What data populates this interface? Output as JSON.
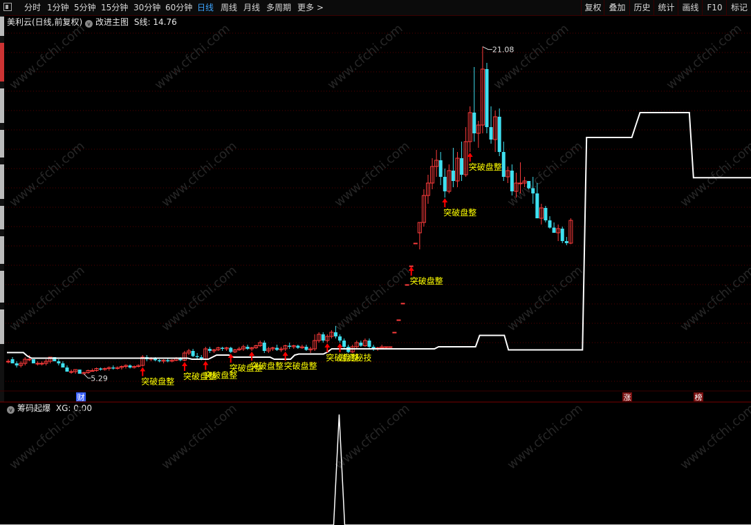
{
  "toolbar": {
    "tabs": [
      {
        "label": "分时",
        "active": false
      },
      {
        "label": "1分钟",
        "active": false
      },
      {
        "label": "5分钟",
        "active": false
      },
      {
        "label": "15分钟",
        "active": false
      },
      {
        "label": "30分钟",
        "active": false
      },
      {
        "label": "60分钟",
        "active": false
      },
      {
        "label": "日线",
        "active": true
      },
      {
        "label": "周线",
        "active": false
      },
      {
        "label": "月线",
        "active": false
      },
      {
        "label": "多周期",
        "active": false
      },
      {
        "label": "更多 >",
        "active": false
      }
    ],
    "right": [
      "复权",
      "叠加",
      "历史",
      "统计",
      "画线",
      "F10",
      "标记"
    ]
  },
  "main": {
    "stock": "美利云(日线,前复权)",
    "indicator": "改进主图",
    "s_label": "S线:",
    "s_value": "14.76",
    "high_label": "21.08",
    "low_label": "5.29",
    "bottom_markers": [
      "财",
      "涨",
      "榜"
    ]
  },
  "sub": {
    "indicator": "筹码起爆",
    "xg_label": "XG:",
    "xg_value": "0.00"
  },
  "watermark": "www.cfchi.com",
  "colors": {
    "up": "#ff3c3c",
    "down": "#3fe0f0",
    "sline": "#ffffff",
    "signal": "#ffff00",
    "arrow": "#ff0000",
    "active": "#3da5ff"
  },
  "chart_data": {
    "type": "candlestick",
    "y_range": [
      4.5,
      22.0
    ],
    "candles": [
      [
        5.9,
        6.0,
        5.8,
        5.9
      ],
      [
        6.0,
        6.1,
        5.8,
        5.8
      ],
      [
        5.8,
        5.9,
        5.6,
        5.7
      ],
      [
        5.7,
        5.9,
        5.6,
        5.8
      ],
      [
        5.8,
        6.1,
        5.7,
        6.0
      ],
      [
        6.0,
        6.2,
        5.9,
        6.0
      ],
      [
        6.0,
        6.0,
        5.8,
        5.8
      ],
      [
        5.8,
        5.9,
        5.7,
        5.8
      ],
      [
        5.8,
        5.9,
        5.7,
        5.8
      ],
      [
        5.8,
        6.0,
        5.7,
        5.9
      ],
      [
        5.9,
        6.1,
        5.8,
        6.1
      ],
      [
        6.1,
        6.1,
        5.9,
        5.9
      ],
      [
        5.9,
        6.0,
        5.7,
        5.8
      ],
      [
        5.8,
        5.9,
        5.6,
        5.6
      ],
      [
        5.6,
        5.7,
        5.4,
        5.4
      ],
      [
        5.4,
        5.5,
        5.3,
        5.4
      ],
      [
        5.4,
        5.5,
        5.3,
        5.5
      ],
      [
        5.5,
        5.5,
        5.3,
        5.3
      ],
      [
        5.3,
        5.4,
        5.29,
        5.35
      ],
      [
        5.35,
        5.5,
        5.3,
        5.45
      ],
      [
        5.45,
        5.55,
        5.4,
        5.45
      ],
      [
        5.45,
        5.6,
        5.4,
        5.55
      ],
      [
        5.55,
        5.6,
        5.45,
        5.5
      ],
      [
        5.5,
        5.6,
        5.45,
        5.55
      ],
      [
        5.55,
        5.65,
        5.45,
        5.6
      ],
      [
        5.6,
        5.7,
        5.5,
        5.55
      ],
      [
        5.55,
        5.65,
        5.5,
        5.6
      ],
      [
        5.6,
        5.7,
        5.5,
        5.65
      ],
      [
        5.65,
        5.75,
        5.55,
        5.7
      ],
      [
        5.7,
        5.75,
        5.55,
        5.6
      ],
      [
        5.6,
        5.7,
        5.55,
        5.65
      ],
      [
        5.65,
        5.75,
        5.6,
        5.7
      ],
      [
        5.7,
        6.2,
        5.65,
        6.1
      ],
      [
        6.1,
        6.2,
        5.9,
        6.0
      ],
      [
        6.0,
        6.1,
        5.9,
        6.05
      ],
      [
        6.05,
        6.1,
        5.9,
        5.95
      ],
      [
        5.95,
        6.0,
        5.85,
        5.9
      ],
      [
        5.9,
        6.0,
        5.8,
        5.95
      ],
      [
        5.95,
        6.05,
        5.85,
        5.9
      ],
      [
        5.9,
        6.0,
        5.85,
        5.95
      ],
      [
        5.95,
        6.1,
        5.9,
        6.05
      ],
      [
        6.05,
        6.1,
        5.9,
        5.95
      ],
      [
        5.95,
        6.4,
        5.9,
        6.3
      ],
      [
        6.3,
        6.5,
        6.2,
        6.4
      ],
      [
        6.4,
        6.5,
        6.1,
        6.15
      ],
      [
        6.15,
        6.3,
        6.0,
        6.1
      ],
      [
        6.1,
        6.2,
        5.95,
        6.0
      ],
      [
        6.0,
        6.6,
        5.95,
        6.5
      ],
      [
        6.5,
        6.6,
        6.3,
        6.4
      ],
      [
        6.4,
        6.5,
        6.3,
        6.45
      ],
      [
        6.45,
        6.6,
        6.4,
        6.55
      ],
      [
        6.55,
        6.6,
        6.4,
        6.5
      ],
      [
        6.5,
        6.6,
        6.4,
        6.55
      ],
      [
        6.55,
        6.6,
        6.3,
        6.35
      ],
      [
        6.35,
        6.5,
        6.3,
        6.45
      ],
      [
        6.45,
        6.6,
        6.4,
        6.5
      ],
      [
        6.5,
        6.7,
        6.4,
        6.6
      ],
      [
        6.6,
        6.7,
        6.45,
        6.5
      ],
      [
        6.5,
        6.6,
        6.4,
        6.55
      ],
      [
        6.55,
        6.7,
        6.5,
        6.65
      ],
      [
        6.65,
        6.9,
        6.6,
        6.8
      ],
      [
        6.8,
        6.9,
        6.3,
        6.4
      ],
      [
        6.4,
        6.6,
        6.3,
        6.5
      ],
      [
        6.5,
        6.6,
        6.4,
        6.55
      ],
      [
        6.55,
        6.7,
        6.4,
        6.45
      ],
      [
        6.45,
        6.6,
        6.35,
        6.5
      ],
      [
        6.5,
        6.7,
        6.4,
        6.65
      ],
      [
        6.65,
        6.8,
        6.5,
        6.6
      ],
      [
        6.6,
        6.7,
        6.5,
        6.65
      ],
      [
        6.65,
        6.7,
        6.5,
        6.55
      ],
      [
        6.55,
        6.7,
        6.5,
        6.6
      ],
      [
        6.6,
        6.7,
        6.4,
        6.45
      ],
      [
        6.45,
        6.6,
        6.3,
        6.5
      ],
      [
        6.5,
        7.2,
        6.4,
        6.9
      ],
      [
        6.9,
        7.3,
        6.8,
        7.2
      ],
      [
        7.2,
        7.3,
        6.8,
        6.9
      ],
      [
        6.9,
        7.2,
        6.8,
        7.1
      ],
      [
        7.1,
        7.4,
        7.0,
        7.3
      ],
      [
        7.3,
        7.6,
        7.0,
        7.1
      ],
      [
        7.1,
        7.2,
        6.8,
        6.9
      ],
      [
        6.9,
        7.0,
        6.5,
        6.6
      ],
      [
        6.6,
        6.7,
        6.3,
        6.35
      ],
      [
        6.35,
        6.7,
        6.3,
        6.6
      ],
      [
        6.6,
        6.9,
        6.5,
        6.8
      ],
      [
        6.8,
        6.9,
        6.6,
        6.65
      ],
      [
        6.65,
        7.0,
        6.6,
        6.9
      ],
      [
        6.9,
        7.0,
        6.5,
        6.6
      ],
      [
        6.6,
        6.7,
        6.4,
        6.5
      ],
      [
        6.5,
        6.6,
        6.4,
        6.55
      ],
      [
        6.55,
        6.7,
        6.5,
        6.6
      ],
      [
        6.6,
        6.6,
        6.5,
        6.6
      ],
      [
        6.6,
        6.6,
        6.6,
        6.6
      ],
      [
        7.3,
        7.3,
        7.3,
        7.3
      ],
      [
        7.9,
        7.9,
        7.9,
        7.9
      ],
      [
        8.7,
        8.7,
        8.7,
        8.7
      ],
      [
        9.6,
        9.6,
        9.6,
        9.6
      ],
      [
        10.5,
        10.5,
        10.5,
        10.5
      ],
      [
        11.6,
        11.6,
        11.6,
        11.6
      ],
      [
        12.1,
        12.6,
        11.3,
        12.6
      ],
      [
        12.6,
        14.2,
        12.4,
        13.9
      ],
      [
        13.9,
        14.9,
        13.5,
        14.5
      ],
      [
        14.5,
        15.7,
        14.2,
        15.3
      ],
      [
        15.3,
        16.1,
        14.8,
        15.6
      ],
      [
        15.6,
        16.0,
        14.4,
        14.8
      ],
      [
        14.8,
        15.2,
        13.8,
        14.1
      ],
      [
        14.1,
        15.4,
        14.0,
        15.1
      ],
      [
        15.1,
        16.2,
        14.3,
        14.6
      ],
      [
        14.6,
        16.0,
        14.3,
        15.7
      ],
      [
        15.7,
        16.5,
        14.6,
        14.9
      ],
      [
        14.9,
        17.2,
        14.8,
        16.5
      ],
      [
        16.5,
        18.2,
        16.0,
        17.9
      ],
      [
        17.9,
        20.1,
        16.5,
        16.9
      ],
      [
        16.9,
        17.5,
        16.2,
        17.3
      ],
      [
        17.3,
        21.08,
        16.9,
        20.0
      ],
      [
        20.0,
        20.3,
        16.9,
        17.2
      ],
      [
        17.2,
        18.2,
        16.4,
        16.6
      ],
      [
        16.6,
        18.0,
        16.0,
        17.7
      ],
      [
        17.7,
        18.1,
        15.8,
        16.0
      ],
      [
        16.0,
        16.5,
        14.6,
        14.8
      ],
      [
        14.8,
        15.3,
        14.5,
        15.1
      ],
      [
        15.1,
        15.4,
        13.9,
        14.1
      ],
      [
        14.1,
        15.0,
        13.8,
        14.5
      ],
      [
        14.5,
        15.5,
        14.0,
        14.5
      ],
      [
        14.5,
        14.8,
        14.3,
        14.6
      ],
      [
        14.6,
        14.6,
        14.2,
        14.25
      ],
      [
        14.25,
        14.8,
        13.5,
        14.0
      ],
      [
        14.0,
        14.5,
        12.8,
        12.8
      ],
      [
        12.8,
        13.5,
        12.5,
        13.3
      ],
      [
        13.3,
        13.4,
        12.6,
        12.7
      ],
      [
        12.7,
        12.9,
        12.3,
        12.35
      ],
      [
        12.35,
        12.6,
        12.1,
        12.1
      ],
      [
        12.1,
        12.5,
        11.7,
        12.3
      ],
      [
        12.3,
        12.4,
        11.6,
        11.7
      ],
      [
        11.7,
        11.9,
        11.5,
        11.6
      ],
      [
        11.6,
        12.8,
        11.55,
        12.7
      ]
    ],
    "s_line": [
      6.32,
      6.32,
      6.32,
      6.32,
      6.32,
      6.15,
      6.05,
      6.05,
      6.05,
      6.05,
      6.05,
      6.05,
      6.05,
      6.05,
      6.05,
      6.05,
      6.05,
      6.05,
      6.05,
      6.05,
      6.05,
      6.05,
      6.05,
      6.05,
      6.05,
      6.05,
      6.05,
      6.05,
      6.05,
      6.05,
      6.05,
      6.05,
      6.05,
      6.05,
      6.05,
      6.05,
      6.05,
      6.05,
      6.05,
      6.05,
      6.05,
      6.05,
      6.05,
      6.05,
      6.05,
      6.0,
      6.0,
      6.0,
      6.0,
      6.0,
      6.1,
      6.2,
      6.2,
      6.2,
      6.2,
      6.1,
      6.1,
      6.1,
      6.1,
      6.1,
      6.1,
      6.1,
      6.1,
      6.1,
      6.1,
      6.0,
      6.0,
      6.0,
      6.0,
      6.0,
      6.2,
      6.25,
      6.25,
      6.25,
      6.25,
      6.25,
      6.25,
      6.25,
      6.35,
      6.5,
      6.5,
      6.5,
      6.5,
      6.5,
      6.5,
      6.5,
      6.5,
      6.5,
      6.5,
      6.5,
      6.5,
      6.5,
      6.5,
      6.5,
      6.5,
      6.5,
      6.5,
      6.5,
      6.5,
      6.5,
      6.5,
      6.5,
      6.5,
      6.5,
      6.5,
      6.6,
      6.6,
      6.6,
      6.6,
      6.6,
      6.6,
      6.6,
      6.6,
      6.6,
      6.6,
      7.15,
      7.15,
      7.15,
      7.15,
      7.15,
      7.15,
      7.15,
      6.45,
      6.45,
      6.45,
      6.45,
      6.45,
      6.45,
      6.45,
      6.45,
      6.45,
      6.45,
      6.45,
      6.45,
      6.45,
      6.45,
      6.45,
      6.45,
      6.45,
      6.45,
      6.45,
      16.7,
      16.7,
      16.7,
      16.7,
      16.7,
      16.7,
      16.7,
      16.7,
      16.7,
      16.7,
      16.7,
      16.7,
      17.3,
      17.9,
      17.9,
      17.9,
      17.9,
      17.9,
      17.9,
      17.9,
      17.9,
      17.9,
      17.9,
      17.9,
      17.9,
      17.9,
      14.76,
      14.76,
      14.76,
      14.76,
      14.76,
      14.76,
      14.76,
      14.76,
      14.76,
      14.76,
      14.76,
      14.76,
      14.76,
      14.76,
      14.76
    ],
    "signals": [
      {
        "i": 32,
        "label": "突破盘整"
      },
      {
        "i": 42,
        "label": "突破盘整"
      },
      {
        "i": 47,
        "label": "突破盘整"
      },
      {
        "i": 53,
        "label": "突破盘整"
      },
      {
        "i": 58,
        "label": "突破盘整"
      },
      {
        "i": 66,
        "label": "突破盘整"
      },
      {
        "i": 76,
        "label": "突破盘整"
      },
      {
        "i": 79,
        "label": "游资秘技"
      },
      {
        "i": 96,
        "label": "突破盘整"
      },
      {
        "i": 104,
        "label": "突破盘整"
      },
      {
        "i": 110,
        "label": "突破盘整"
      }
    ],
    "xg": {
      "spike_index": 78,
      "spike_value": 1,
      "baseline": 0
    }
  }
}
